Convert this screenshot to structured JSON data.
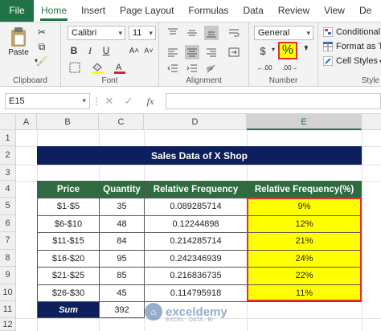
{
  "tabs": [
    "File",
    "Home",
    "Insert",
    "Page Layout",
    "Formulas",
    "Data",
    "Review",
    "View",
    "De"
  ],
  "ribbon": {
    "clipboard": {
      "label": "Clipboard",
      "paste": "Paste"
    },
    "font": {
      "label": "Font",
      "name": "Calibri",
      "size": "11"
    },
    "alignment": {
      "label": "Alignment"
    },
    "number": {
      "label": "Number",
      "format": "General",
      "percent": "%"
    },
    "styles": {
      "label": "Style",
      "conditional": "Conditional",
      "format_as_table": "Format as Ta",
      "cell_styles": "Cell Styles"
    }
  },
  "formula_bar": {
    "name_box": "E15",
    "fx": "fx"
  },
  "columns": [
    "A",
    "B",
    "C",
    "D",
    "E"
  ],
  "rows": [
    "1",
    "2",
    "3",
    "4",
    "5",
    "6",
    "7",
    "8",
    "9",
    "10",
    "11",
    "12"
  ],
  "sheet": {
    "title": "Sales Data of X Shop",
    "headers": [
      "Price",
      "Quantity",
      "Relative Frequency",
      "Relative Frequency(%)"
    ],
    "data": [
      [
        "$1-$5",
        "35",
        "0.089285714",
        "9%"
      ],
      [
        "$6-$10",
        "48",
        "0.12244898",
        "12%"
      ],
      [
        "$11-$15",
        "84",
        "0.214285714",
        "21%"
      ],
      [
        "$16-$20",
        "95",
        "0.242346939",
        "24%"
      ],
      [
        "$21-$25",
        "85",
        "0.216836735",
        "22%"
      ],
      [
        "$26-$30",
        "45",
        "0.114795918",
        "11%"
      ]
    ],
    "sum_label": "Sum",
    "sum_value": "392"
  },
  "watermark": {
    "name": "exceldemy",
    "tagline": "EXCEL · DATA · BI"
  },
  "colors": {
    "excel_green": "#217346",
    "title_navy": "#0d1f5c",
    "header_green": "#2e6b3f",
    "highlight": "#ffff00",
    "outline_red": "#e03030"
  }
}
